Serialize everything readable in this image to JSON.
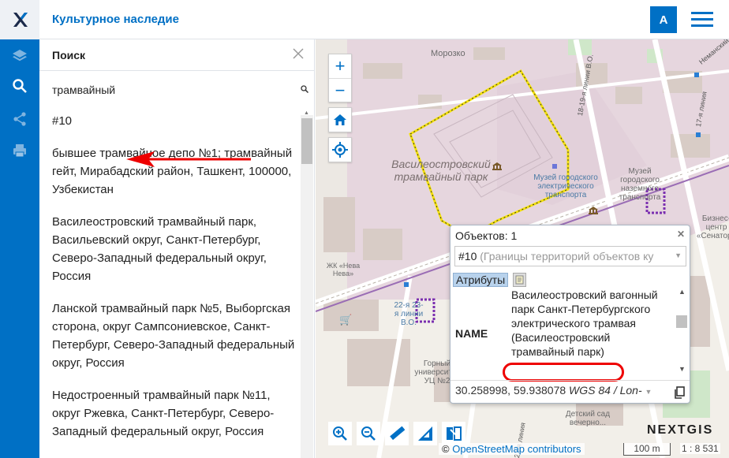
{
  "app": {
    "title": "Культурное наследие",
    "logo": "X",
    "user_initial": "A"
  },
  "icons": {
    "logo": "x-logo-icon",
    "menu": "hamburger-icon",
    "layers": "layers-icon",
    "search": "search-icon",
    "share": "share-icon",
    "print": "print-icon"
  },
  "panel": {
    "title": "Поиск",
    "query": "трамвайный",
    "results": [
      "#10",
      "бывшее трамвайное депо №1; трамвайный гейт, Мирабадский район, Ташкент, 100000, Узбекистан",
      "Василеостровский трамвайный парк, Васильевский округ, Санкт-Петербург, Северо-Западный федеральный округ, Россия",
      "Ланской трамвайный парк №5, Выборгская сторона, округ Сампсониевское, Санкт-Петербург, Северо-Западный федеральный округ, Россия",
      "Недостроенный трамвайный парк №11, округ Ржевка, Санкт-Петербург, Северо-Западный федеральный округ, Россия"
    ]
  },
  "map": {
    "labels": {
      "morozko": "Морозко",
      "park": "Василеостровский трамвайный парк",
      "museum": "Музей городского электрического транспорта",
      "museum2": "Музей городского наземного транспорта",
      "business": "Бизнес-центр «Сенатор»",
      "zhk": "ЖК «Нева Нева»",
      "mining": "Горный университет УЦ №2",
      "liniya_22_23": "22-я 23-я линии В.О.",
      "liniya_18_19": "18-19-я линии В.О.",
      "liniya_17_18": "17-я линия",
      "liniya_23_24": "23-я линия",
      "nemansky": "Неманский",
      "school": "Детский сад вечерно..."
    },
    "attribution_prefix": "©",
    "attribution_link": "OpenStreetMap contributors",
    "scale": "100 m",
    "scale_ratio": "1 : 8 531",
    "brand": "NEXTGIS",
    "colors": {
      "boundary": "#f5e20c",
      "tram": "#7b2fb0",
      "accent": "#0070c5"
    }
  },
  "popup": {
    "title": "Объектов: 1",
    "select_value": "#10",
    "select_hint": "(Границы территорий объектов ку",
    "tab": "Атрибуты",
    "attr_key": "NAME",
    "attr_value": "Василеостровский вагонный парк Санкт-Петербургского электрического трамвая (Василеостровский трамвайный парк)",
    "coords": "30.258998, 59.938078",
    "crs": "WGS 84 / Lon-"
  }
}
